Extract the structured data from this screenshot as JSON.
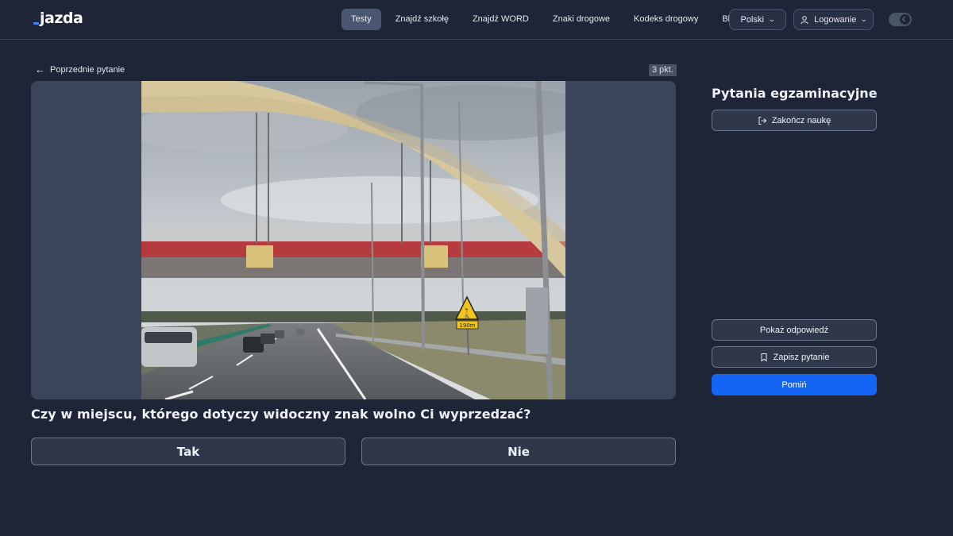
{
  "header": {
    "logo_text": "jazda",
    "nav": [
      "Testy",
      "Znajdź szkołę",
      "Znajdź WORD",
      "Znaki drogowe",
      "Kodeks drogowy",
      "Blog"
    ],
    "active_nav": "Testy",
    "language": "Polski",
    "login_label": "Logowanie",
    "theme_toggle_icon": "moon-icon"
  },
  "main": {
    "back_label": "Poprzednie pytanie",
    "points": "3 pkt.",
    "question": "Czy w miejscu, którego dotyczy widoczny znak wolno Ci wyprzedzać?",
    "answers": [
      "Tak",
      "Nie"
    ],
    "sign_distance_text": "190m"
  },
  "sidebar": {
    "title": "Pytania egzaminacyjne",
    "end_label": "Zakończ naukę",
    "show_answer_label": "Pokaż odpowiedź",
    "save_label": "Zapisz pytanie",
    "skip_label": "Pomiń"
  },
  "colors": {
    "background": "#1e2537",
    "accent": "#1565f5",
    "active_nav_bg": "#4b5670"
  }
}
